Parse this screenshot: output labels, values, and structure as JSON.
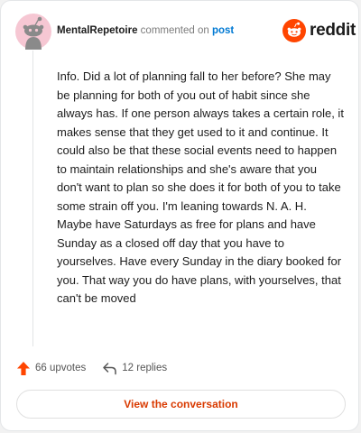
{
  "header": {
    "username": "MentalRepetoire",
    "action_text": "commented on",
    "post_link_text": "post"
  },
  "brand": {
    "logo_icon": "reddit-snoo-icon",
    "wordmark": "reddit",
    "accent_color": "#ff4500"
  },
  "comment": {
    "body": "Info. Did a lot of planning fall to her before? She may be planning for both of you out of habit since she always has. If one person always takes a certain role, it makes sense that they get used to it and continue. It could also be that these social events need to happen to maintain relationships and she's aware that you don't want to plan so she does it for both of you to take some strain off you. I'm leaning towards N. A. H. Maybe have Saturdays as free for plans and have Sunday as a closed off day that you have to yourselves. Have every Sunday in the diary booked for you. That way you do have plans, with yourselves, that can't be moved"
  },
  "stats": {
    "upvotes_icon": "upvote-arrow-icon",
    "upvotes_text": "66 upvotes",
    "replies_icon": "reply-arrow-icon",
    "replies_text": "12 replies"
  },
  "cta": {
    "label": "View the conversation",
    "color": "#d93a00"
  }
}
